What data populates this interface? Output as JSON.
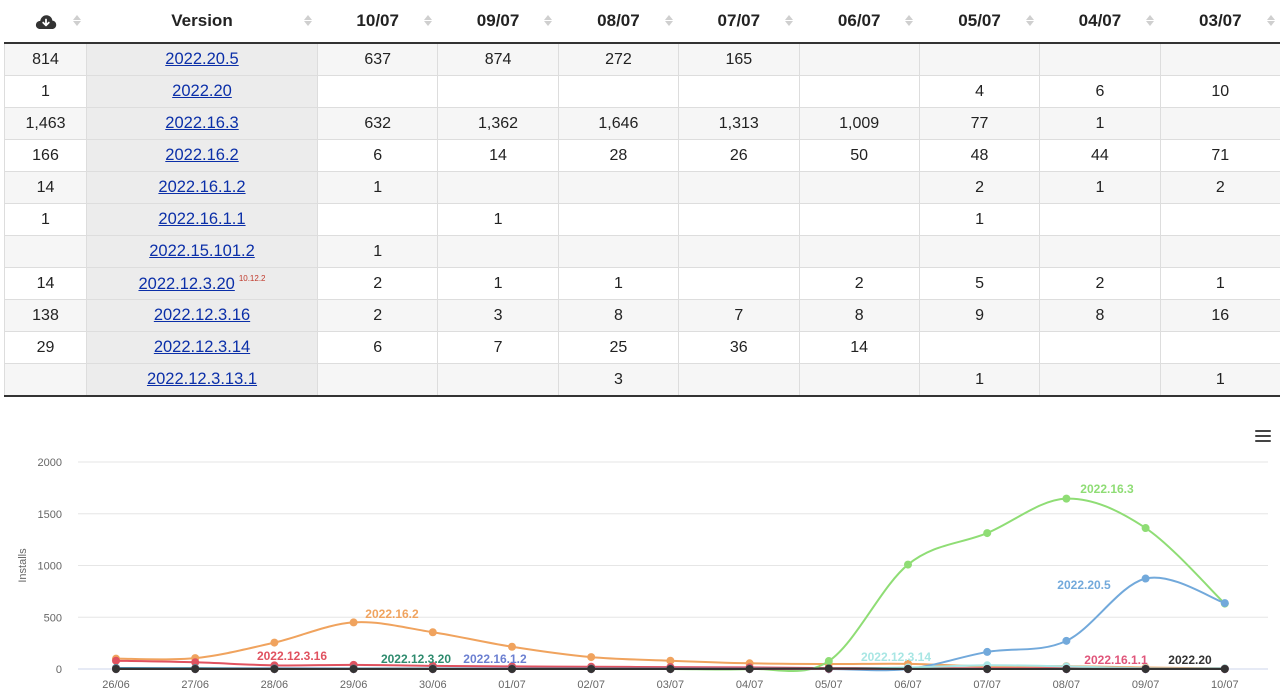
{
  "table": {
    "headers": [
      "Version",
      "10/07",
      "09/07",
      "08/07",
      "07/07",
      "06/07",
      "05/07",
      "04/07",
      "03/07"
    ],
    "download_icon": "cloud-download-icon",
    "rows": [
      {
        "total": "814",
        "version": "2022.20.5",
        "note": "",
        "cells": [
          "637",
          "874",
          "272",
          "165",
          "",
          "",
          "",
          ""
        ]
      },
      {
        "total": "1",
        "version": "2022.20",
        "note": "",
        "cells": [
          "",
          "",
          "",
          "",
          "",
          "4",
          "6",
          "10"
        ]
      },
      {
        "total": "1,463",
        "version": "2022.16.3",
        "note": "",
        "cells": [
          "632",
          "1,362",
          "1,646",
          "1,313",
          "1,009",
          "77",
          "1",
          ""
        ]
      },
      {
        "total": "166",
        "version": "2022.16.2",
        "note": "",
        "cells": [
          "6",
          "14",
          "28",
          "26",
          "50",
          "48",
          "44",
          "71"
        ]
      },
      {
        "total": "14",
        "version": "2022.16.1.2",
        "note": "",
        "cells": [
          "1",
          "",
          "",
          "",
          "",
          "2",
          "1",
          "2"
        ]
      },
      {
        "total": "1",
        "version": "2022.16.1.1",
        "note": "",
        "cells": [
          "",
          "1",
          "",
          "",
          "",
          "1",
          "",
          ""
        ]
      },
      {
        "total": "",
        "version": "2022.15.101.2",
        "note": "",
        "cells": [
          "1",
          "",
          "",
          "",
          "",
          "",
          "",
          ""
        ]
      },
      {
        "total": "14",
        "version": "2022.12.3.20",
        "note": "10.12.2",
        "cells": [
          "2",
          "1",
          "1",
          "",
          "2",
          "5",
          "2",
          "1"
        ]
      },
      {
        "total": "138",
        "version": "2022.12.3.16",
        "note": "",
        "cells": [
          "2",
          "3",
          "8",
          "7",
          "8",
          "9",
          "8",
          "16"
        ]
      },
      {
        "total": "29",
        "version": "2022.12.3.14",
        "note": "",
        "cells": [
          "6",
          "7",
          "25",
          "36",
          "14",
          "",
          "",
          ""
        ]
      },
      {
        "total": "",
        "version": "2022.12.3.13.1",
        "note": "",
        "cells": [
          "",
          "",
          "3",
          "",
          "",
          "1",
          "",
          "1"
        ]
      }
    ]
  },
  "chart_data": {
    "type": "line",
    "ylabel": "Installs",
    "ylim": [
      0,
      2000
    ],
    "yticks": [
      0,
      500,
      1000,
      1500,
      2000
    ],
    "grid": true,
    "x": [
      "26/06",
      "27/06",
      "28/06",
      "29/06",
      "30/06",
      "01/07",
      "02/07",
      "03/07",
      "04/07",
      "05/07",
      "06/07",
      "07/07",
      "08/07",
      "09/07",
      "10/07"
    ],
    "series": [
      {
        "name": "2022.16.2",
        "color": "#f0a35e",
        "values": [
          100,
          105,
          255,
          450,
          355,
          215,
          115,
          80,
          55,
          48,
          50,
          26,
          28,
          14,
          6
        ]
      },
      {
        "name": "2022.12.3.16",
        "color": "#e05260",
        "values": [
          80,
          65,
          35,
          40,
          30,
          25,
          22,
          18,
          16,
          9,
          8,
          7,
          8,
          3,
          2
        ]
      },
      {
        "name": "2022.16.3",
        "color": "#8fdd75",
        "values": [
          0,
          0,
          0,
          0,
          0,
          0,
          0,
          0,
          0,
          77,
          1009,
          1313,
          1646,
          1362,
          632
        ]
      },
      {
        "name": "2022.20.5",
        "color": "#72a9db",
        "values": [
          0,
          0,
          0,
          0,
          0,
          0,
          0,
          0,
          0,
          0,
          0,
          165,
          272,
          874,
          637
        ]
      },
      {
        "name": "2022.12.3.14",
        "color": "#a8e6e4",
        "values": [
          0,
          0,
          0,
          0,
          0,
          0,
          0,
          0,
          0,
          0,
          14,
          36,
          25,
          7,
          6
        ]
      },
      {
        "name": "2022.12.3.20",
        "color": "#2e8b6e",
        "values": [
          10,
          8,
          6,
          5,
          5,
          4,
          4,
          3,
          3,
          5,
          2,
          0,
          1,
          1,
          2
        ]
      },
      {
        "name": "2022.16.1.2",
        "color": "#6b7fd1",
        "values": [
          5,
          4,
          4,
          3,
          3,
          3,
          2,
          2,
          2,
          2,
          0,
          0,
          0,
          0,
          1
        ]
      },
      {
        "name": "2022.16.1.1",
        "color": "#e0557a",
        "values": [
          0,
          0,
          0,
          0,
          0,
          0,
          0,
          0,
          0,
          1,
          0,
          0,
          0,
          1,
          0
        ]
      },
      {
        "name": "2022.20",
        "color": "#333333",
        "values": [
          0,
          0,
          0,
          0,
          0,
          0,
          0,
          0,
          0,
          4,
          0,
          0,
          0,
          0,
          0
        ]
      }
    ],
    "annotations": [
      {
        "text": "2022.16.3",
        "color": "#8fdd75"
      },
      {
        "text": "2022.16.2",
        "color": "#f0a35e"
      },
      {
        "text": "2022.20.5",
        "color": "#72a9db"
      },
      {
        "text": "2022.12.3.16",
        "color": "#e05260"
      },
      {
        "text": "2022.12.3.20",
        "color": "#2e8b6e"
      },
      {
        "text": "2022.16.1.2",
        "color": "#6b7fd1"
      },
      {
        "text": "2022.12.3.14",
        "color": "#a8e6e4"
      },
      {
        "text": "2022.16.1.1",
        "color": "#e0557a"
      },
      {
        "text": "2022.20",
        "color": "#333333"
      }
    ]
  },
  "chart_menu_icon": "hamburger-menu-icon"
}
